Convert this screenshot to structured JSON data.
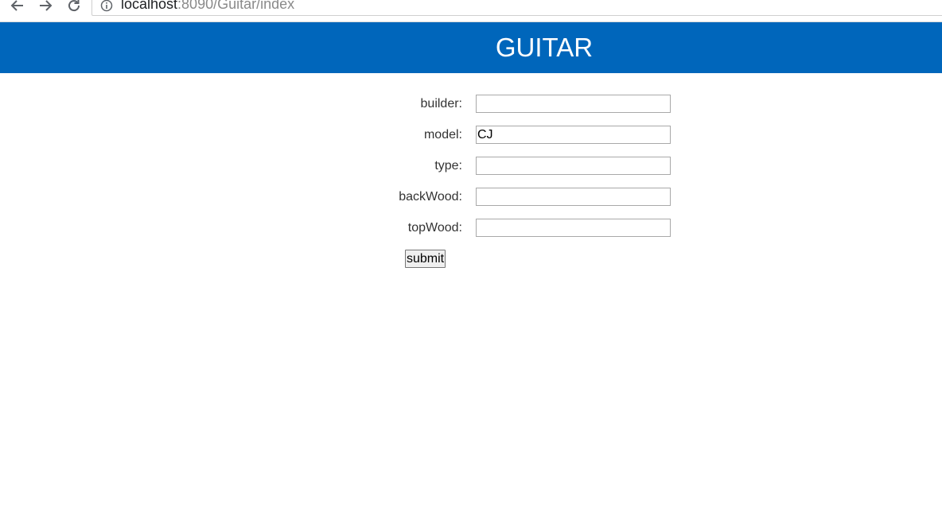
{
  "browser": {
    "url_host": "localhost",
    "url_path": ":8090/Guitar/index",
    "back_icon": "arrow-left-icon",
    "forward_icon": "arrow-right-icon",
    "reload_icon": "reload-icon",
    "info_icon": "info-icon"
  },
  "header": {
    "title": "GUITAR",
    "background_color": "#0066bb"
  },
  "form": {
    "fields": [
      {
        "label": "builder:",
        "value": ""
      },
      {
        "label": "model:",
        "value": "CJ"
      },
      {
        "label": "type:",
        "value": ""
      },
      {
        "label": "backWood:",
        "value": ""
      },
      {
        "label": "topWood:",
        "value": ""
      }
    ],
    "submit_label": "submit"
  }
}
